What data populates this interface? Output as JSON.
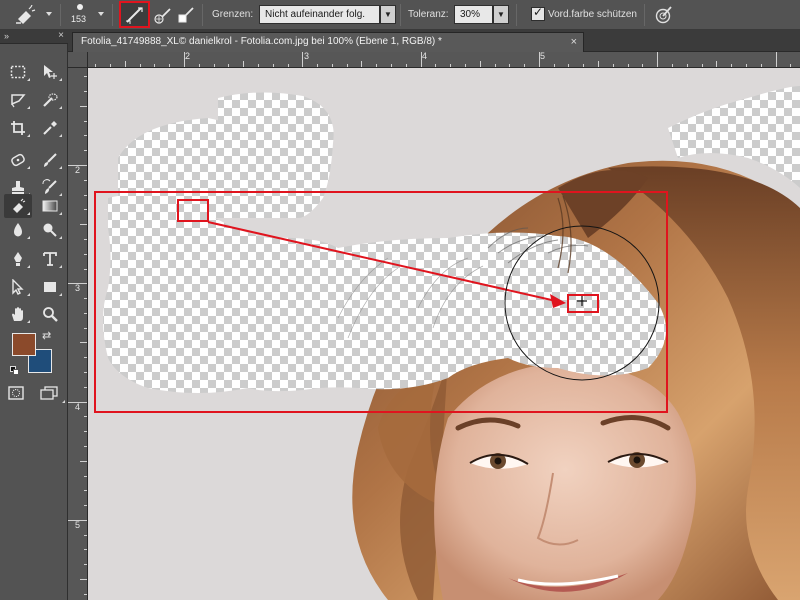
{
  "options_bar": {
    "brush_size": "153",
    "limits_label": "Grenzen:",
    "limits_value": "Nicht aufeinander folg.",
    "tolerance_label": "Toleranz:",
    "tolerance_value": "30%",
    "protect_foreground_label": "Vord.farbe schützen",
    "protect_foreground_checked": true
  },
  "document": {
    "tab_title": "Fotolia_41749888_XL© danielkrol - Fotolia.com.jpg bei 100% (Ebene 1, RGB/8) *",
    "close_glyph": "×"
  },
  "rulers": {
    "top": [
      "2",
      "3",
      "4",
      "5"
    ],
    "left": [
      "2",
      "3",
      "4",
      "5"
    ]
  },
  "colors": {
    "foreground": "#8b4a2b",
    "background": "#1f4d7a",
    "annotation": "#e0141e",
    "ui_panel": "#535353"
  },
  "tools": [
    "marquee-tool",
    "move-tool",
    "lasso-tool",
    "quick-selection-tool",
    "crop-tool",
    "eyedropper-tool",
    "spot-healing-tool",
    "brush-tool",
    "clone-stamp-tool",
    "history-brush-tool",
    "background-eraser-tool",
    "gradient-tool",
    "blur-tool",
    "dodge-tool",
    "pen-tool",
    "type-tool",
    "path-selection-tool",
    "rectangle-tool",
    "hand-tool",
    "zoom-tool"
  ]
}
